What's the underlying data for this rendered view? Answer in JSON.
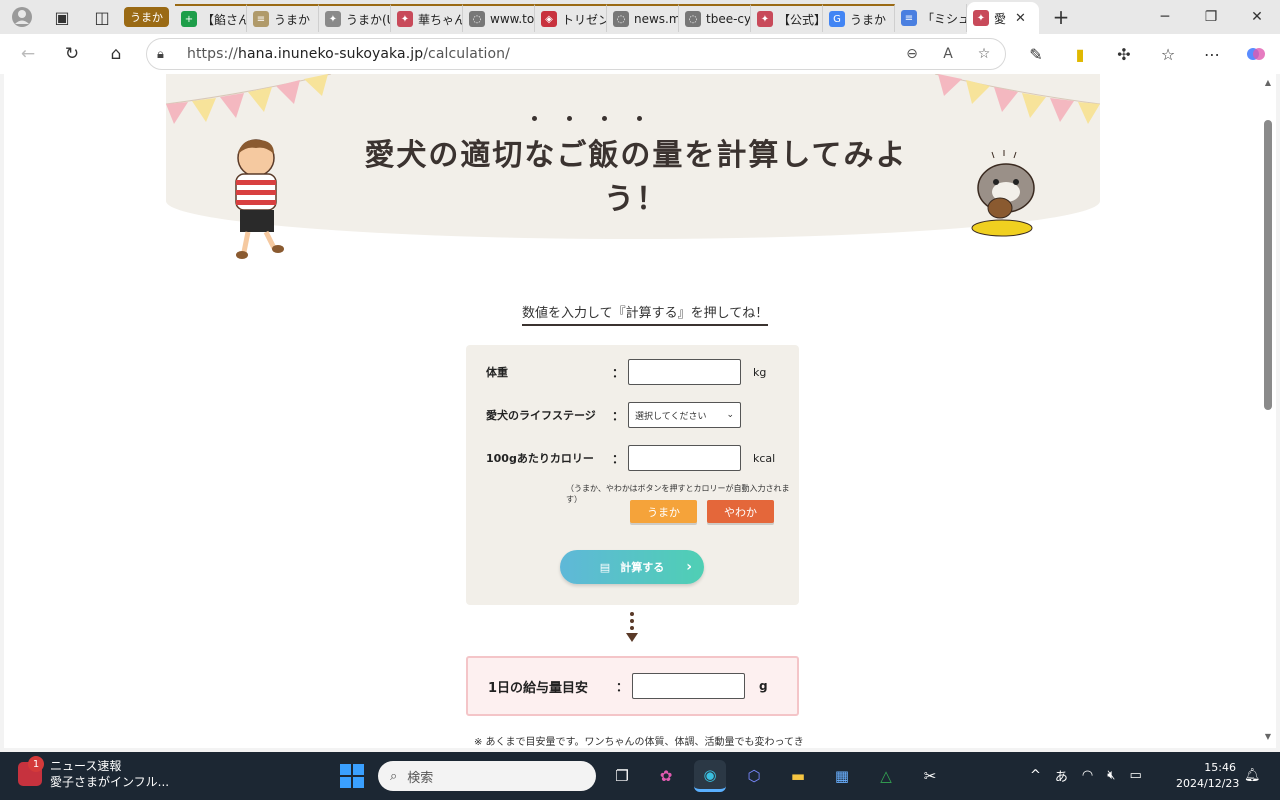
{
  "browser": {
    "tab_group": "うまか",
    "tabs": [
      {
        "title": "【餡さん",
        "fav": "+",
        "color": "#1e9e4a"
      },
      {
        "title": "うまか（",
        "fav": "≡",
        "color": "#b09a6a"
      },
      {
        "title": "うまか(U",
        "fav": "✦",
        "color": "#8a8a8a"
      },
      {
        "title": "華ちゃん",
        "fav": "✦",
        "color": "#c84a5a"
      },
      {
        "title": "www.to",
        "fav": "◌",
        "color": "#777"
      },
      {
        "title": "トリゼン",
        "fav": "◈",
        "color": "#c8323e"
      },
      {
        "title": "news.m",
        "fav": "◌",
        "color": "#777"
      },
      {
        "title": "tbee-cy",
        "fav": "◌",
        "color": "#777"
      },
      {
        "title": "【公式】",
        "fav": "✦",
        "color": "#c84a5a"
      },
      {
        "title": "うまか",
        "fav": "G",
        "color": "#4285f4"
      },
      {
        "title": "「ミシュワ",
        "fav": "≡",
        "color": "#4a7fe0"
      },
      {
        "title": "愛",
        "fav": "✦",
        "color": "#c84a5a"
      }
    ],
    "url_prefix": "https://",
    "url_host": "hana.inuneko-sukoyaka.jp",
    "url_path": "/calculation/"
  },
  "page": {
    "hero_title": "愛犬の適切なご飯の量を計算してみよう！",
    "instruction": "数値を入力して『計算する』を押してね！",
    "form": {
      "weight_label": "体重",
      "weight_unit": "kg",
      "weight_value": "",
      "stage_label": "愛犬のライフステージ",
      "stage_selected": "選択してください",
      "calorie_label": "100gあたりカロリー",
      "calorie_unit": "kcal",
      "calorie_value": "",
      "colon": "：",
      "note": "（うまか、やわかはボタンを押すとカロリーが自動入力されます）",
      "btn_umaka": "うまか",
      "btn_yawaka": "やわか",
      "calc_button": "計算する"
    },
    "result": {
      "label": "1日の給与量目安",
      "unit": "g",
      "value": ""
    },
    "footnote": "※ あくまで目安量です。ワンちゃんの体質、体調、活動量でも変わってき"
  },
  "taskbar": {
    "news_title": "ニュース速報",
    "news_sub": "愛子さまがインフル...",
    "news_badge": "1",
    "search_placeholder": "検索",
    "ime": "あ",
    "time": "15:46",
    "date": "2024/12/23"
  },
  "colors": {
    "btn_umaka": "#f5a33a",
    "btn_yawaka": "#e4673a",
    "accent": "#5fb8d8"
  }
}
